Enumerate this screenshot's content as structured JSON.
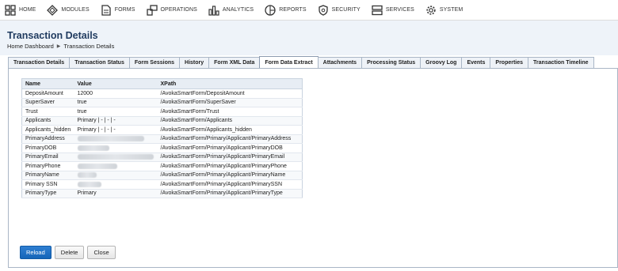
{
  "nav": {
    "items": [
      {
        "label": "HOME",
        "icon": "grid-icon"
      },
      {
        "label": "MODULES",
        "icon": "diamond-icon"
      },
      {
        "label": "FORMS",
        "icon": "document-icon"
      },
      {
        "label": "OPERATIONS",
        "icon": "operations-icon"
      },
      {
        "label": "ANALYTICS",
        "icon": "bar-chart-icon"
      },
      {
        "label": "REPORTS",
        "icon": "reports-icon"
      },
      {
        "label": "SECURITY",
        "icon": "shield-icon"
      },
      {
        "label": "SERVICES",
        "icon": "server-icon"
      },
      {
        "label": "SYSTEM",
        "icon": "gear-icon"
      }
    ]
  },
  "page": {
    "title": "Transaction Details",
    "breadcrumb": [
      "Home Dashboard",
      "Transaction Details"
    ]
  },
  "tabs": [
    {
      "label": "Transaction Details",
      "active": false
    },
    {
      "label": "Transaction Status",
      "active": false
    },
    {
      "label": "Form Sessions",
      "active": false
    },
    {
      "label": "History",
      "active": false
    },
    {
      "label": "Form XML Data",
      "active": false
    },
    {
      "label": "Form Data Extract",
      "active": true
    },
    {
      "label": "Attachments",
      "active": false
    },
    {
      "label": "Processing Status",
      "active": false
    },
    {
      "label": "Groovy Log",
      "active": false
    },
    {
      "label": "Events",
      "active": false
    },
    {
      "label": "Properties",
      "active": false
    },
    {
      "label": "Transaction Timeline",
      "active": false
    }
  ],
  "table": {
    "headers": {
      "name": "Name",
      "value": "Value",
      "xpath": "XPath"
    },
    "rows": [
      {
        "name": "DepositAmount",
        "value": "12000",
        "xpath": "/AvokaSmartForm/DepositAmount"
      },
      {
        "name": "SuperSaver",
        "value": "true",
        "xpath": "/AvokaSmartForm/SuperSaver"
      },
      {
        "name": "Trust",
        "value": "true",
        "xpath": "/AvokaSmartForm/Trust"
      },
      {
        "name": "Applicants",
        "value": "Primary | - | - | -",
        "xpath": "/AvokaSmartForm/Applicants"
      },
      {
        "name": "Applicants_hidden",
        "value": "Primary | - | - | -",
        "xpath": "/AvokaSmartForm/Applicants_hidden"
      },
      {
        "name": "PrimaryAddress",
        "value": "",
        "redacted": true,
        "xpath": "/AvokaSmartForm/Primary/Applicant/PrimaryAddress"
      },
      {
        "name": "PrimaryDOB",
        "value": "",
        "redacted": true,
        "xpath": "/AvokaSmartForm/Primary/Applicant/PrimaryDOB"
      },
      {
        "name": "PrimaryEmail",
        "value": "",
        "redacted": true,
        "xpath": "/AvokaSmartForm/Primary/Applicant/PrimaryEmail"
      },
      {
        "name": "PrimaryPhone",
        "value": "",
        "redacted": true,
        "xpath": "/AvokaSmartForm/Primary/Applicant/PrimaryPhone"
      },
      {
        "name": "PrimaryName",
        "value": "",
        "redacted": true,
        "xpath": "/AvokaSmartForm/Primary/Applicant/PrimaryName"
      },
      {
        "name": "Primary SSN",
        "value": "",
        "redacted": true,
        "xpath": "/AvokaSmartForm/Primary/Applicant/PrimarySSN"
      },
      {
        "name": "PrimaryType",
        "value": "Primary",
        "xpath": "/AvokaSmartForm/Primary/Applicant/PrimaryType"
      }
    ]
  },
  "actions": {
    "reload": "Reload",
    "delete": "Delete",
    "close": "Close"
  },
  "colors": {
    "accent": "#1565b8",
    "title": "#1f3a5f",
    "titlebar_bg": "#eef3f9"
  }
}
